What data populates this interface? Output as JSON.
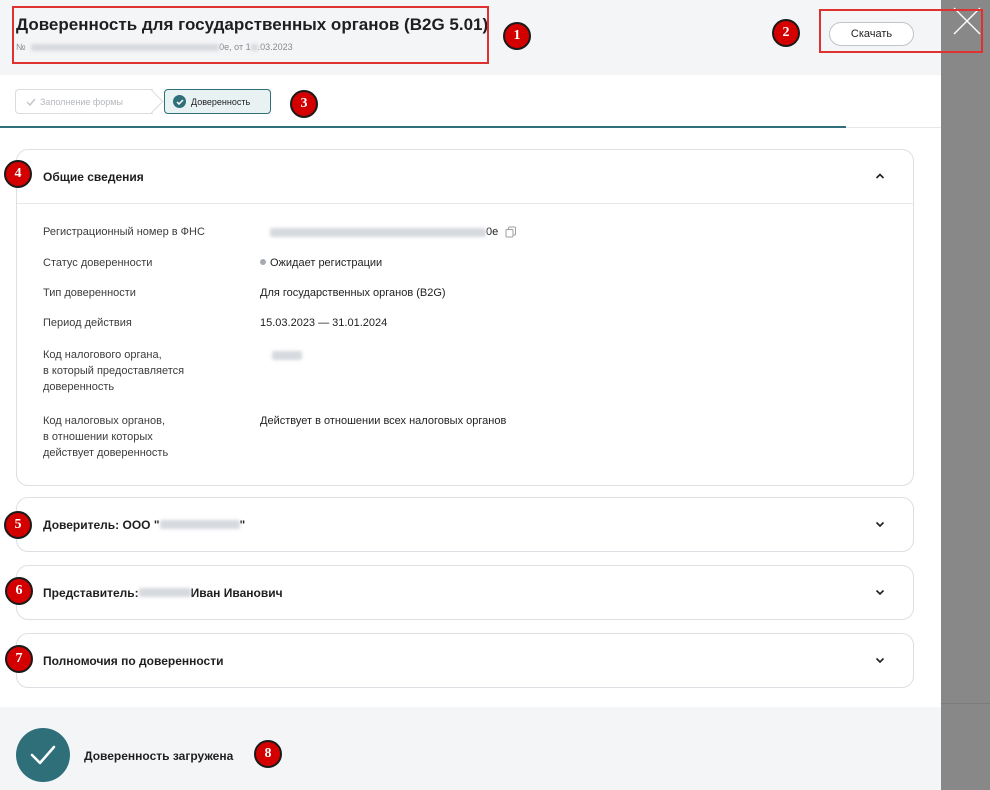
{
  "header": {
    "title": "Доверенность для государственных органов (B2G 5.01)",
    "number_prefix": "№",
    "number_suffix": "0e, от 1",
    "date_suffix": ".03.2023",
    "download_label": "Скачать"
  },
  "close_label": "✕",
  "steps": [
    {
      "label": "Заполнение формы",
      "state": "done"
    },
    {
      "label": "Доверенность",
      "state": "active"
    }
  ],
  "general": {
    "title": "Общие сведения",
    "rows": {
      "reg_number_label": "Регистрационный номер в ФНС",
      "reg_number_suffix": "0e",
      "status_label": "Статус доверенности",
      "status_value": "Ожидает регистрации",
      "type_label": "Тип доверенности",
      "type_value": "Для государственных органов (B2G)",
      "period_label": "Период действия",
      "period_value": "15.03.2023 — 31.01.2024",
      "tax_code_label_1": "Код налогового органа,",
      "tax_code_label_2": "в который предоставляется",
      "tax_code_label_3": "доверенность",
      "tax_codes_label_1": "Код налоговых органов,",
      "tax_codes_label_2": "в отношении которых",
      "tax_codes_label_3": "действует доверенность",
      "tax_codes_value": "Действует в отношении всех налоговых органов"
    }
  },
  "principal": {
    "prefix": "Доверитель: ООО \"",
    "suffix": "\""
  },
  "representative": {
    "prefix": "Представитель: ",
    "suffix": " Иван Иванович"
  },
  "powers": {
    "title": "Полномочия по доверенности"
  },
  "footer": {
    "text": "Доверенность загружена"
  },
  "callouts": [
    "1",
    "2",
    "3",
    "4",
    "5",
    "6",
    "7",
    "8"
  ],
  "colors": {
    "accent": "#2f6f7a",
    "callout": "#d40000",
    "header_bg": "#f4f5f7"
  }
}
